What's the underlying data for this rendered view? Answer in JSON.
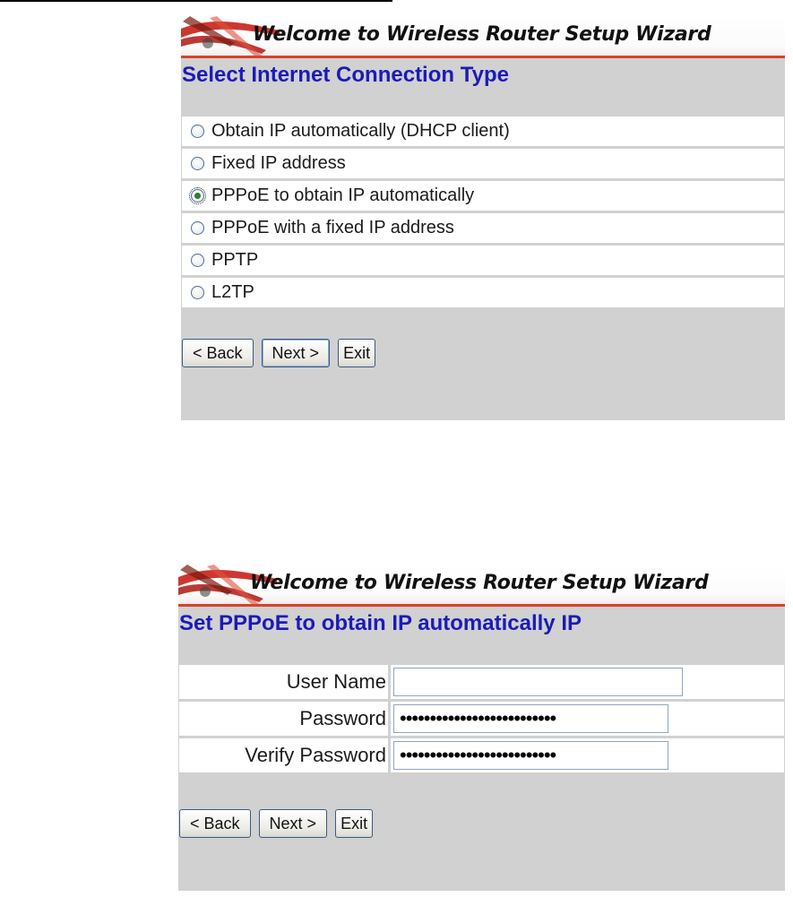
{
  "wizard_step1": {
    "banner_title": "Welcome to Wireless Router Setup Wizard",
    "section_title": "Select Internet Connection Type",
    "options": [
      {
        "label": "Obtain IP automatically (DHCP client)",
        "checked": false
      },
      {
        "label": "Fixed IP address",
        "checked": false
      },
      {
        "label": "PPPoE to obtain IP automatically",
        "checked": true
      },
      {
        "label": "PPPoE with a fixed IP address",
        "checked": false
      },
      {
        "label": "PPTP",
        "checked": false
      },
      {
        "label": "L2TP",
        "checked": false
      }
    ],
    "buttons": {
      "back": "< Back",
      "next": "Next >",
      "exit": "Exit"
    }
  },
  "wizard_step2": {
    "banner_title": "Welcome to Wireless Router Setup Wizard",
    "section_title": "Set PPPoE to obtain IP automatically IP",
    "fields": {
      "username": {
        "label": "User Name",
        "value": ""
      },
      "password": {
        "label": "Password",
        "value": "••••••••••••••••••••••••••"
      },
      "verify_password": {
        "label": "Verify Password",
        "value": "••••••••••••••••••••••••••"
      }
    },
    "buttons": {
      "back": "< Back",
      "next": "Next >",
      "exit": "Exit"
    }
  },
  "colors": {
    "title_blue": "#1b1bb8",
    "panel_gray": "#d1d1d1",
    "banner_accent": "#d9412a",
    "radio_selected": "#2e7d2e"
  }
}
